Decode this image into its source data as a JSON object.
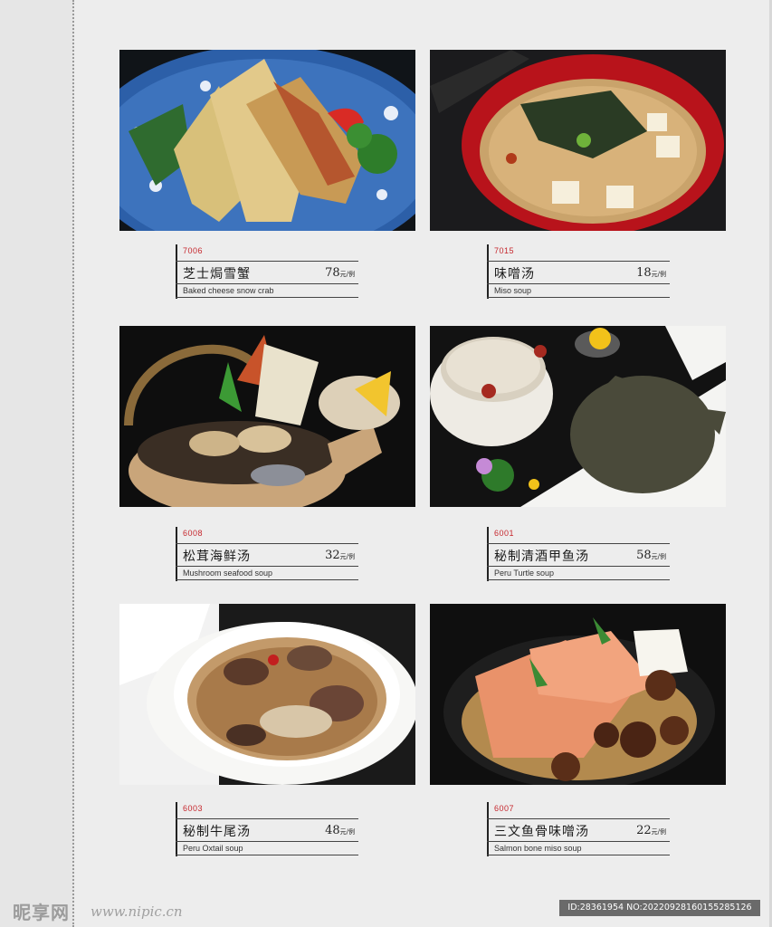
{
  "price_unit": "元/例",
  "items": [
    {
      "code": "7006",
      "cn": "芝士焗雪蟹",
      "price": "78",
      "en": "Baked cheese snow crab"
    },
    {
      "code": "7015",
      "cn": "味噌汤",
      "price": "18",
      "en": "Miso soup"
    },
    {
      "code": "6008",
      "cn": "松茸海鲜汤",
      "price": "32",
      "en": "Mushroom seafood soup"
    },
    {
      "code": "6001",
      "cn": "秘制清酒甲鱼汤",
      "price": "58",
      "en": "Peru Turtle soup"
    },
    {
      "code": "6003",
      "cn": "秘制牛尾汤",
      "price": "48",
      "en": "Peru Oxtail soup"
    },
    {
      "code": "6007",
      "cn": "三文鱼骨味噌汤",
      "price": "22",
      "en": "Salmon bone miso soup"
    }
  ],
  "watermark": {
    "logo": "昵享网",
    "url": "www.nipic.cn",
    "id": "ID:28361954 NO:20220928160155285126"
  }
}
